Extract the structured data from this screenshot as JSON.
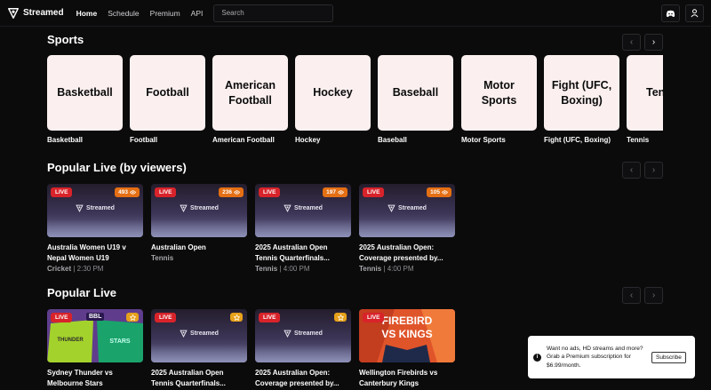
{
  "brand": {
    "name": "Streamed"
  },
  "nav": {
    "links": [
      {
        "label": "Home"
      },
      {
        "label": "Schedule"
      },
      {
        "label": "Premium"
      },
      {
        "label": "API"
      }
    ],
    "search_placeholder": "Search"
  },
  "sports": {
    "title": "Sports",
    "items": [
      {
        "tile": "Basketball",
        "label": "Basketball"
      },
      {
        "tile": "Football",
        "label": "Football"
      },
      {
        "tile": "American Football",
        "label": "American Football"
      },
      {
        "tile": "Hockey",
        "label": "Hockey"
      },
      {
        "tile": "Baseball",
        "label": "Baseball"
      },
      {
        "tile": "Motor Sports",
        "label": "Motor Sports"
      },
      {
        "tile": "Fight (UFC, Boxing)",
        "label": "Fight (UFC, Boxing)"
      },
      {
        "tile": "Tennis",
        "label": "Tennis"
      }
    ]
  },
  "popular_live_viewers": {
    "title": "Popular Live (by viewers)",
    "items": [
      {
        "live": "LIVE",
        "viewers": "493",
        "thumb_text": "Streamed",
        "title": "Australia Women U19 v Nepal Women U19",
        "category": "Cricket",
        "sep": "|",
        "time": "2:30 PM"
      },
      {
        "live": "LIVE",
        "viewers": "236",
        "thumb_text": "Streamed",
        "title": "Australian Open",
        "category": "Tennis",
        "sep": "",
        "time": ""
      },
      {
        "live": "LIVE",
        "viewers": "197",
        "thumb_text": "Streamed",
        "title": "2025 Australian Open Tennis Quarterfinals...",
        "category": "Tennis",
        "sep": "|",
        "time": "4:00 PM"
      },
      {
        "live": "LIVE",
        "viewers": "105",
        "thumb_text": "Streamed",
        "title": "2025 Australian Open: Coverage presented by...",
        "category": "Tennis",
        "sep": "|",
        "time": "4:00 PM"
      }
    ]
  },
  "popular_live": {
    "title": "Popular Live",
    "items": [
      {
        "live": "LIVE",
        "thumb_text": "BBL",
        "title": "Sydney Thunder vs Melbourne Stars"
      },
      {
        "live": "LIVE",
        "thumb_text": "Streamed",
        "title": "2025 Australian Open Tennis Quarterfinals..."
      },
      {
        "live": "LIVE",
        "thumb_text": "Streamed",
        "title": "2025 Australian Open: Coverage presented by..."
      },
      {
        "live": "LIVE",
        "thumb_line1": "FIREBIRD",
        "thumb_line2": "VS KINGS",
        "title": "Wellington Firebirds vs Canterbury Kings"
      }
    ]
  },
  "toast": {
    "text": "Want no ads, HD streams and more? Grab a Premium subscription for $6.99/month.",
    "button": "Subscribe"
  },
  "colors": {
    "live": "#d8232a",
    "viewers": "#e46f14",
    "star": "#e7a11b",
    "tile": "#fbf0ef"
  }
}
